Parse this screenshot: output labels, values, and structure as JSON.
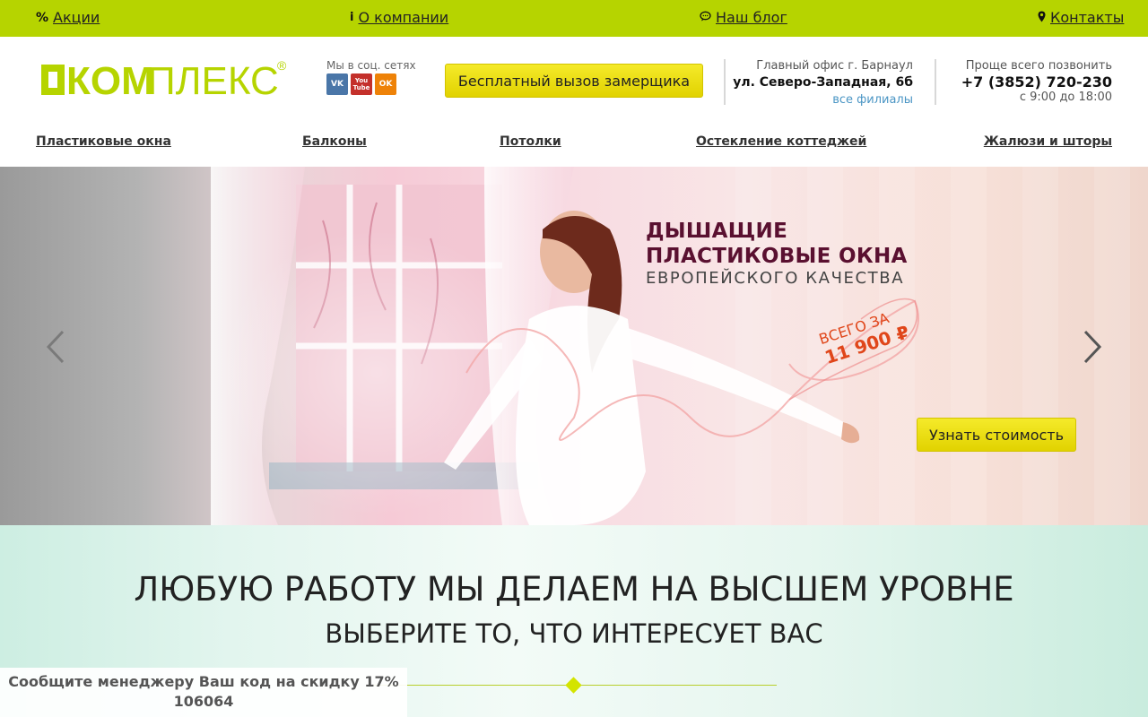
{
  "topbar": {
    "links": [
      {
        "icon": "percent-icon",
        "glyph": "%",
        "label": "Акции"
      },
      {
        "icon": "info-icon",
        "glyph": "i",
        "label": "О компании"
      },
      {
        "icon": "chat-icon",
        "glyph": "💬",
        "label": "Наш блог"
      },
      {
        "icon": "location-pin-icon",
        "glyph": "⚲",
        "label": "Контакты"
      }
    ]
  },
  "header": {
    "logo_text": "КОМПЛЕКС",
    "logo_mark": "®",
    "social_label": "Мы в соц. сетях",
    "social": [
      {
        "name": "vk-icon",
        "text": "VK",
        "color": "#4a76a8"
      },
      {
        "name": "youtube-icon",
        "text": "You Tube",
        "color": "#c4302b"
      },
      {
        "name": "odnoklassniki-icon",
        "text": "OK",
        "color": "#ee8208"
      }
    ],
    "measure_button": "Бесплатный вызов замерщика",
    "office": {
      "line1": "Главный офис г. Барнаул",
      "line2": "ул. Северо-Западная, 6б",
      "link": "все филиалы"
    },
    "phone": {
      "line1": "Проще всего позвонить",
      "number": "+7 (3852) 720-230",
      "hours": "с 9:00 до 18:00"
    }
  },
  "nav": {
    "items": [
      "Пластиковые окна",
      "Балконы",
      "Потолки",
      "Остекление коттеджей",
      "Жалюзи и шторы"
    ]
  },
  "hero": {
    "line1": "ДЫШАЩИЕ",
    "line2": "ПЛАСТИКОВЫЕ ОКНА",
    "line3": "ЕВРОПЕЙСКОГО КАЧЕСТВА",
    "price_prefix": "ВСЕГО ЗА",
    "price_value": "11 900 ₽",
    "cta_button": "Узнать стоимость"
  },
  "section": {
    "title": "ЛЮБУЮ РАБОТУ МЫ ДЕЛАЕМ НА ВЫСШЕМ УРОВНЕ",
    "subtitle": "ВЫБЕРИТЕ ТО, ЧТО ИНТЕРЕСУЕТ ВАС"
  },
  "discount": {
    "line1": "Сообщите менеджеру Ваш код на скидку 17%",
    "code": "106064"
  },
  "colors": {
    "accent_green": "#b6d400",
    "button_yellow": "#f0e31a",
    "link_blue": "#4a95c4",
    "hero_title": "#5a1030",
    "price_orange": "#e0461a"
  }
}
